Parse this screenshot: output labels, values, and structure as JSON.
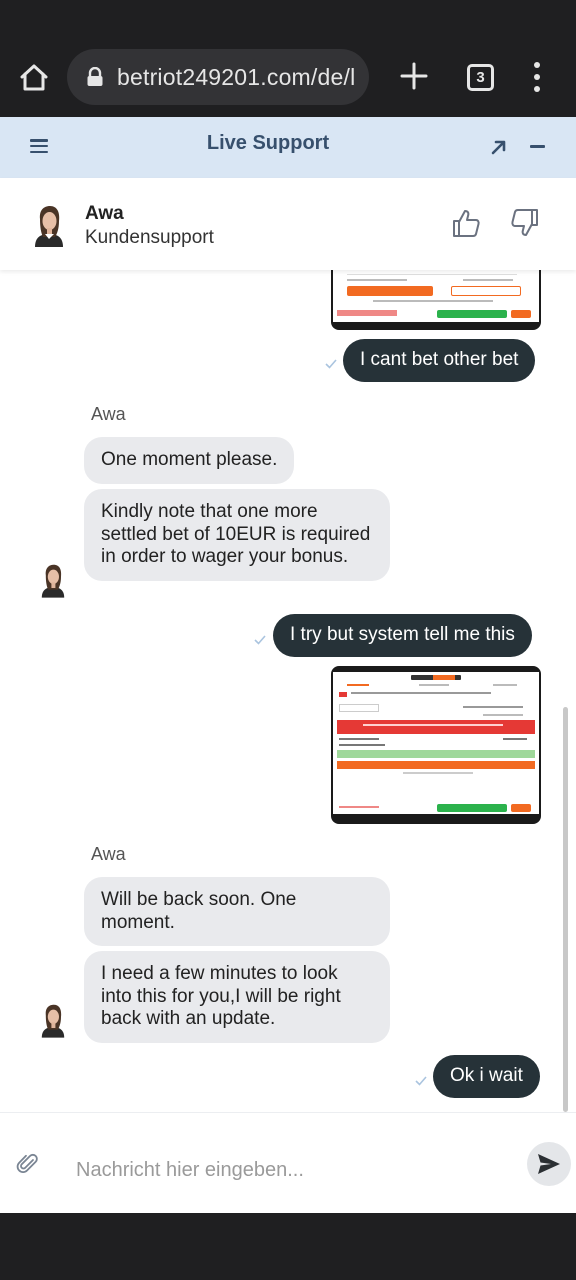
{
  "browser": {
    "url": "betriot249201.com/de/l",
    "tab_count": "3"
  },
  "widget": {
    "title": "Live Support"
  },
  "agent": {
    "name": "Awa",
    "role": "Kundensupport"
  },
  "messages": [
    {
      "direction": "out",
      "type": "image"
    },
    {
      "direction": "out",
      "type": "text",
      "text": "I cant bet other bet"
    },
    {
      "direction": "in",
      "sender": "Awa",
      "type": "text",
      "text": "One moment please."
    },
    {
      "direction": "in",
      "type": "text",
      "text": "Kindly note that one more settled bet of 10EUR is required in order to wager your bonus."
    },
    {
      "direction": "out",
      "type": "text",
      "text": "I try but system tell me this"
    },
    {
      "direction": "out",
      "type": "image"
    },
    {
      "direction": "in",
      "sender": "Awa",
      "type": "text",
      "text": "Will be back soon. One moment."
    },
    {
      "direction": "in",
      "type": "text",
      "text": "I need a few minutes to look into this for you,I will be right back with an update."
    },
    {
      "direction": "out",
      "type": "text",
      "text": "Ok i wait"
    }
  ],
  "composer": {
    "placeholder": "Nachricht hier eingeben..."
  },
  "icons": [
    "home-icon",
    "lock-icon",
    "plus-icon",
    "tabs-icon",
    "more-vert-icon",
    "hamburger-icon",
    "expand-icon",
    "minimize-icon",
    "thumb-up-icon",
    "thumb-down-icon",
    "check-icon",
    "paperclip-icon",
    "send-icon"
  ],
  "colors": {
    "header_bg": "#d9e6f4",
    "header_text": "#37506d",
    "out_bubble": "#263238",
    "in_bubble": "#e9eaed"
  }
}
